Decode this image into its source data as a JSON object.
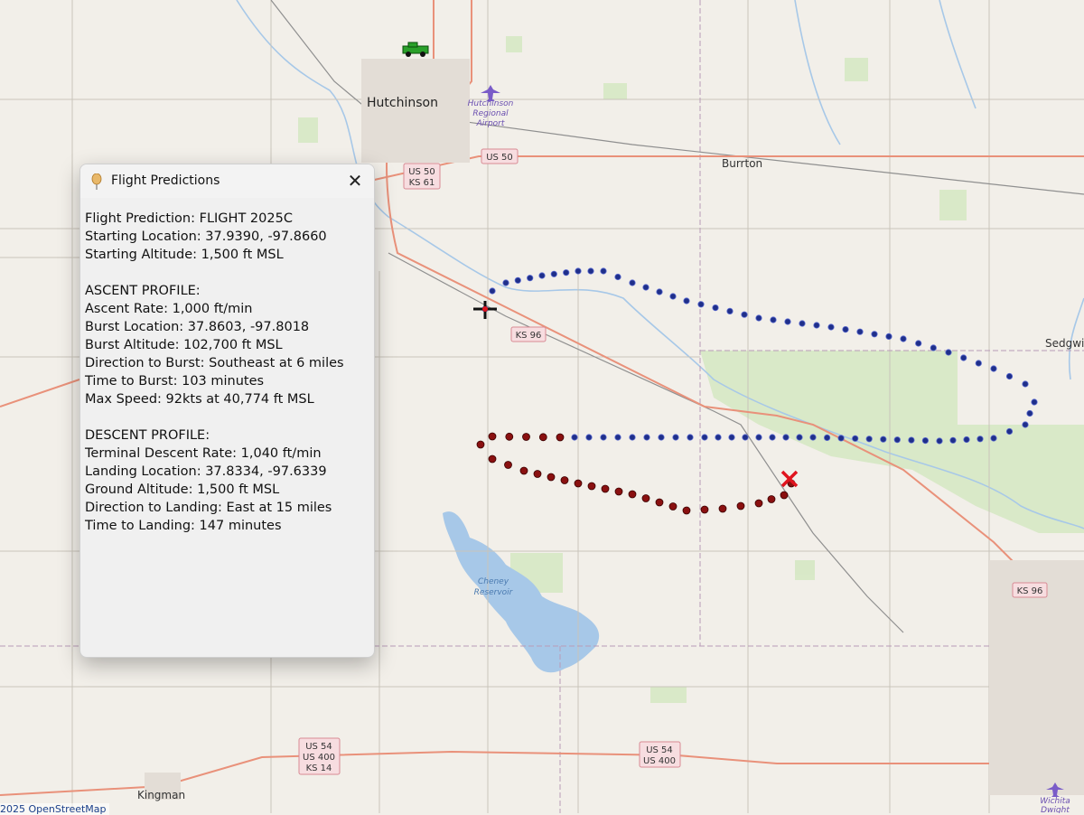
{
  "map": {
    "places": {
      "hutchinson": "Hutchinson",
      "burrton": "Burrton",
      "sedgwick": "Sedgwic",
      "kingman": "Kingman"
    },
    "airports": {
      "hutchinson_line1": "Hutchinson",
      "hutchinson_line2": "Regional",
      "hutchinson_line3": "Airport",
      "wichita_line1": "Wichita",
      "wichita_line2": "Dwight"
    },
    "water": {
      "cheney_line1": "Cheney",
      "cheney_line2": "Reservoir"
    },
    "shields": {
      "us50_ks61_a": "US 50",
      "us50_ks61_b": "KS 61",
      "us50": "US 50",
      "ks96_west": "KS 96",
      "ks96_east": "KS 96",
      "us54_cluster_a": "US 54",
      "us54_cluster_b": "US 400",
      "us54_cluster_c": "KS 14",
      "us54_east_a": "US 54",
      "us54_east_b": "US 400"
    },
    "attribution": "2025 OpenStreetMap",
    "colors": {
      "ascent_marker": "#1f2f8a",
      "descent_marker": "#8a1010",
      "landing_marker": "#e0141e",
      "launch_marker": "#111111",
      "road_major": "#e9917a",
      "water": "#a7c8e8"
    },
    "icons": {
      "chase_vehicle": "jeep-icon",
      "launch": "crosshair-icon",
      "landing": "x-mark-icon",
      "airport": "airplane-icon"
    }
  },
  "panel": {
    "title": "Flight Predictions",
    "close_glyph": "✕",
    "lines": {
      "flight": "Flight Prediction: FLIGHT 2025C",
      "start_loc": "Starting Location: 37.9390, -97.8660",
      "start_alt": "Starting Altitude: 1,500 ft MSL",
      "ascent_header": "ASCENT PROFILE:",
      "ascent_rate": "Ascent Rate: 1,000 ft/min",
      "burst_loc": "Burst Location: 37.8603, -97.8018",
      "burst_alt": "Burst Altitude: 102,700 ft MSL",
      "burst_dir": "Direction to Burst: Southeast at 6 miles",
      "burst_time": "Time to Burst: 103 minutes",
      "max_speed": "Max Speed: 92kts at 40,774 ft MSL",
      "descent_header": "DESCENT PROFILE:",
      "descent_rate": "Terminal Descent Rate: 1,040 ft/min",
      "landing_loc": "Landing Location: 37.8334, -97.6339",
      "ground_alt": "Ground Altitude: 1,500 ft MSL",
      "landing_dir": "Direction to Landing: East at 15 miles",
      "landing_time": "Time to Landing: 147 minutes"
    }
  }
}
